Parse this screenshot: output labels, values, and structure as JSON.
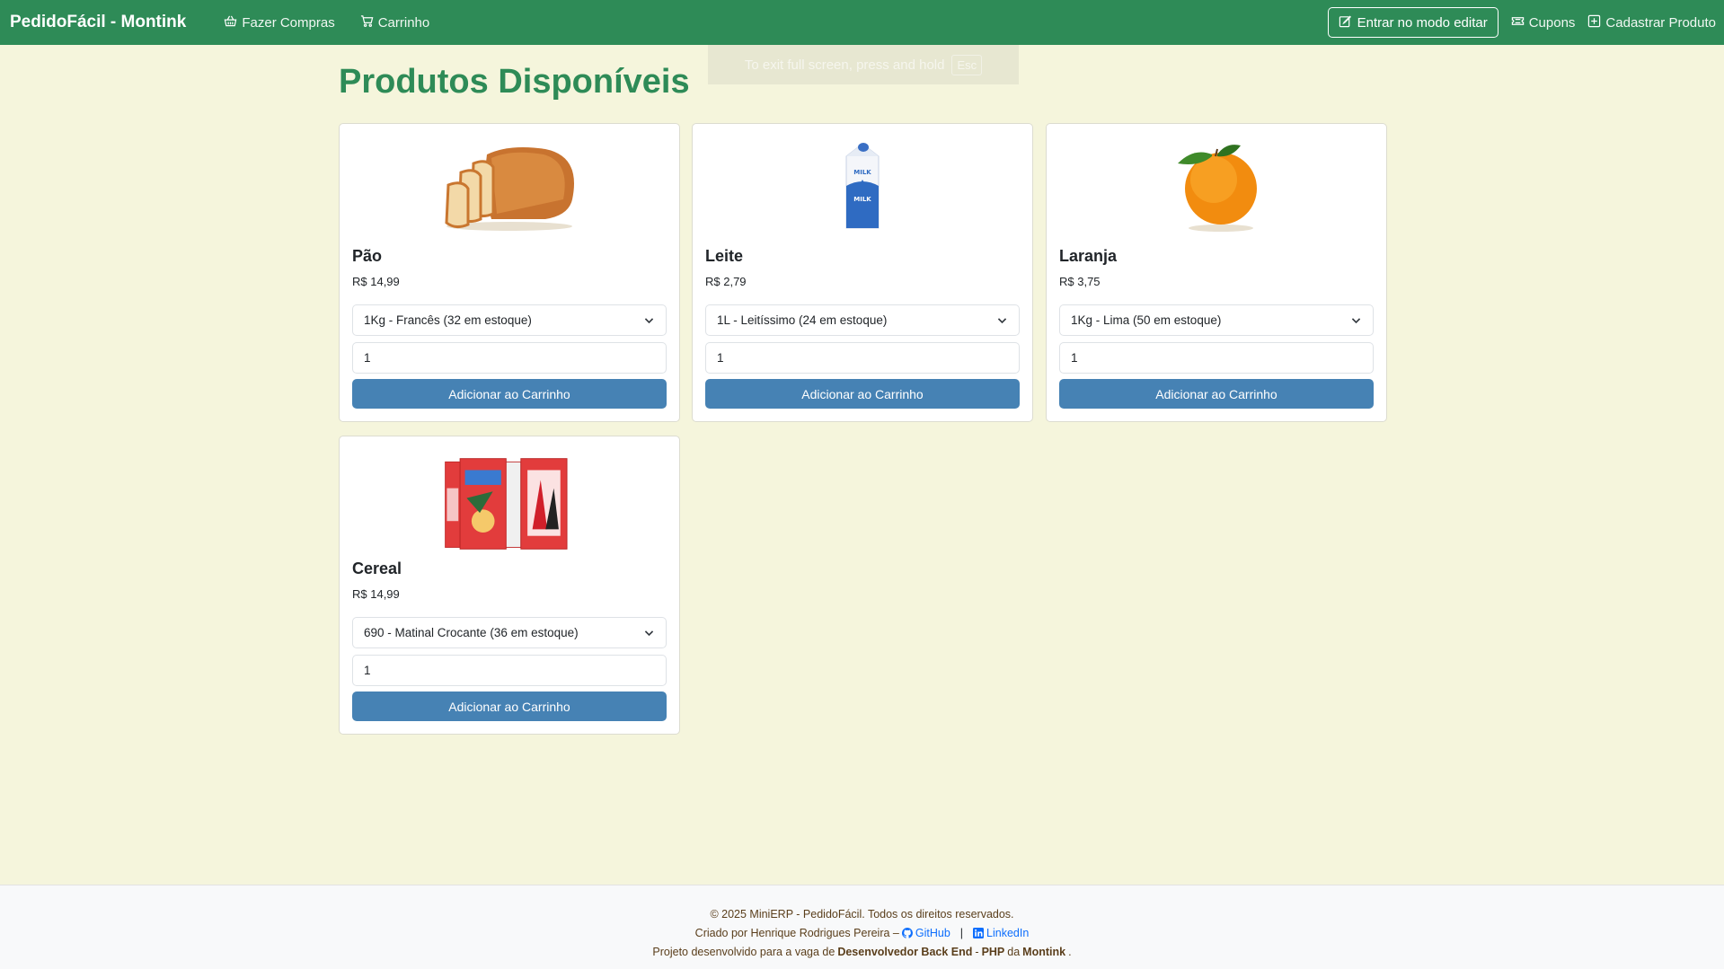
{
  "navbar": {
    "brand": "PedidoFácil - Montink",
    "links": [
      {
        "label": "Fazer Compras",
        "icon": "basket-icon"
      },
      {
        "label": "Carrinho",
        "icon": "cart-icon"
      }
    ],
    "edit_button": "Entrar no modo editar",
    "right_links": [
      {
        "label": "Cupons",
        "icon": "ticket-icon"
      },
      {
        "label": "Cadastrar Produto",
        "icon": "plus-square-icon"
      }
    ]
  },
  "fullscreen_toast": {
    "text": "To exit full screen, press and hold",
    "key": "Esc"
  },
  "main": {
    "title": "Produtos Disponíveis",
    "add_to_cart_label": "Adicionar ao Carrinho",
    "products": [
      {
        "name": "Pão",
        "price": "R$ 14,99",
        "variant": "1Kg - Francês (32 em estoque)",
        "quantity": "1",
        "image": "bread"
      },
      {
        "name": "Leite",
        "price": "R$ 2,79",
        "variant": "1L - Leitíssimo (24 em estoque)",
        "quantity": "1",
        "image": "milk"
      },
      {
        "name": "Laranja",
        "price": "R$ 3,75",
        "variant": "1Kg - Lima (50 em estoque)",
        "quantity": "1",
        "image": "orange"
      },
      {
        "name": "Cereal",
        "price": "R$ 14,99",
        "variant": "690 - Matinal Crocante (36 em estoque)",
        "quantity": "1",
        "image": "cereal"
      }
    ]
  },
  "footer": {
    "copyright": "© 2025 MiniERP - PedidoFácil. Todos os direitos reservados.",
    "credit_prefix": "Criado por Henrique Rodrigues Pereira –",
    "github_label": "GitHub",
    "separator": "|",
    "linkedin_label": "LinkedIn",
    "project_prefix": "Projeto desenvolvido para a vaga de",
    "project_role": "Desenvolvedor Back End",
    "dash": "-",
    "project_lang": "PHP",
    "project_da": "da",
    "project_company": "Montink",
    "period": "."
  },
  "colors": {
    "navbar": "#2e8b57",
    "background": "#f5f5dc",
    "title": "#2e8b57",
    "button": "#4682b4",
    "footer_text": "#5a3e1b",
    "link": "#0d6efd"
  }
}
